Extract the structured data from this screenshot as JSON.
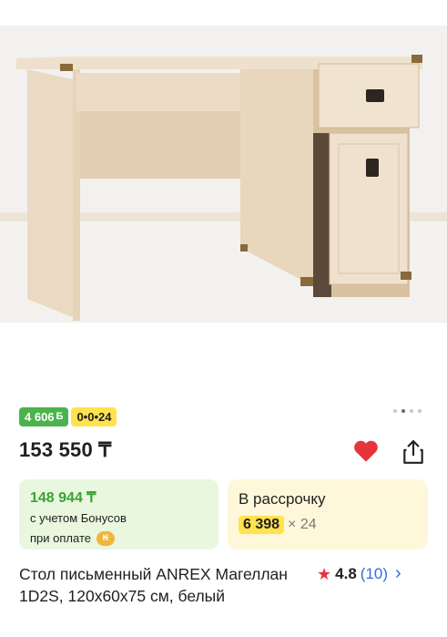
{
  "product": {
    "image_alt": "desk-photo",
    "bonus_badge": "4 606",
    "bonus_currency": "Б",
    "installment_badge": "0•0•24",
    "price": "153 550 ₸",
    "bonus_card": {
      "price": "148 944 ₸",
      "line1": "с учетом Бонусов",
      "line2": "при оплате",
      "coin_icon": "kaspi-coin-icon"
    },
    "installment_card": {
      "title": "В рассрочку",
      "monthly": "6 398",
      "months": "× 24"
    },
    "name": "Стол письменный ANREX Магеллан 1D2S, 120x60x75 см, белый",
    "rating": {
      "star": "★",
      "score": "4.8",
      "count": "(10)",
      "chevron": "›"
    }
  },
  "colors": {
    "bonus_green": "#4bb34b",
    "installment_yellow": "#ffe24d",
    "heart_red": "#e5343a",
    "link_blue": "#2f6ed4"
  },
  "carousel": {
    "total": 4,
    "active": 2
  }
}
